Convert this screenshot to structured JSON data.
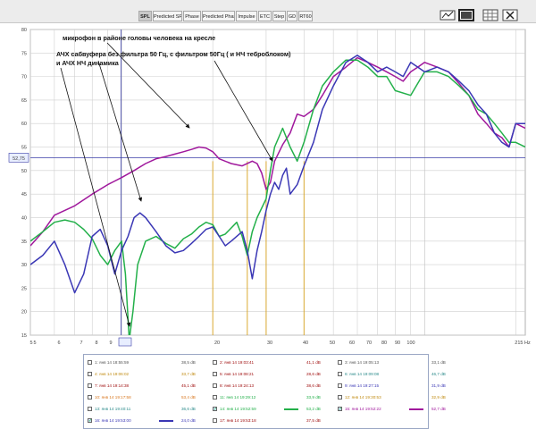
{
  "toolbar": {
    "tabs": [
      {
        "label": "SPL",
        "active": true
      },
      {
        "label": "Predicted SPL",
        "active": false
      },
      {
        "label": "Phase",
        "active": false
      },
      {
        "label": "Predicted Phase",
        "active": false
      },
      {
        "label": "Impulse",
        "active": false
      },
      {
        "label": "ETC",
        "active": false
      },
      {
        "label": "Step",
        "active": false
      },
      {
        "label": "GD",
        "active": false
      },
      {
        "label": "RT60",
        "active": false
      }
    ],
    "icons": [
      "trace-arrangement-icon",
      "window-icon",
      "grid-icon",
      "close-icon"
    ]
  },
  "graph": {
    "cursor_readout": "52,75",
    "x_cursor_readout": "9,96",
    "x_unit": "Hz",
    "annotations": {
      "line1": "микрофон в районе головы человека на кресле",
      "line2": "АЧХ сабвуфера без фильтра 50 Гц, с фильтром 50Гц ( и НЧ теброблоком)",
      "line3": "и АЧХ НЧ динамика"
    },
    "colors": {
      "magenta": "#a0189c",
      "green": "#23b04a",
      "blue": "#3a37b5",
      "cursor_line": "#3a3fa8",
      "marker_line": "#d8a21d",
      "grid": "#cfcfcf",
      "arrow": "#111111"
    }
  },
  "chart_data": {
    "type": "line",
    "title": "",
    "xlabel": "Hz",
    "ylabel": "",
    "x_scale": "log",
    "xlim": [
      5,
      215
    ],
    "ylim": [
      15,
      80
    ],
    "x_ticks": [
      "5",
      "5",
      "6",
      "7",
      "8",
      "9",
      "9,96",
      "20",
      "30",
      "40",
      "50",
      "60",
      "70",
      "80",
      "90",
      "100",
      "215 Hz"
    ],
    "y_ticks": [
      15,
      20,
      25,
      30,
      35,
      40,
      45,
      50,
      52.75,
      55,
      60,
      65,
      70,
      75,
      80
    ],
    "marker_frequencies": [
      20,
      26,
      30,
      40
    ],
    "cursor_y": 52.75,
    "grid": true,
    "series": [
      {
        "name": "",
        "color": "#a0189c",
        "x": [
          5,
          5.5,
          6,
          7,
          8,
          9,
          10,
          11,
          12,
          13,
          14,
          15,
          16,
          17,
          18,
          19,
          20,
          21,
          23,
          25,
          27,
          28,
          29,
          30,
          31,
          32,
          34,
          36,
          38,
          40,
          43,
          46,
          50,
          55,
          60,
          65,
          70,
          75,
          80,
          85,
          90,
          95,
          100,
          110,
          120,
          130,
          140,
          150,
          160,
          170,
          180,
          190,
          200,
          215
        ],
        "y": [
          34,
          37,
          40.5,
          42.5,
          45,
          47,
          48.5,
          50,
          51.5,
          52.5,
          53,
          53.5,
          54,
          54.5,
          55,
          54.8,
          54,
          52.5,
          51.5,
          51,
          52,
          51.5,
          49.5,
          46,
          47.5,
          52,
          55.5,
          58,
          62,
          61.5,
          63,
          66,
          70,
          72,
          74,
          73,
          72,
          71,
          70,
          69,
          71,
          72,
          73,
          72,
          71,
          68.5,
          66,
          62,
          60,
          58,
          57,
          55,
          60,
          59
        ]
      },
      {
        "name": "",
        "color": "#23b04a",
        "x": [
          5,
          5.5,
          6,
          6.5,
          7,
          7.5,
          8,
          8.5,
          9,
          9.5,
          10,
          10.3,
          10.6,
          10.9,
          11.3,
          12,
          13,
          14,
          15,
          16,
          17,
          18,
          19,
          20,
          21,
          22,
          24,
          25,
          26,
          27,
          28,
          30,
          31,
          32,
          34,
          36,
          38,
          40,
          43,
          46,
          50,
          55,
          60,
          65,
          70,
          75,
          80,
          90,
          100,
          110,
          120,
          130,
          140,
          150,
          160,
          170,
          180,
          190,
          200,
          215
        ],
        "y": [
          35,
          37,
          39,
          39.5,
          39,
          37.5,
          35.5,
          32,
          30,
          33,
          35,
          28,
          14,
          20,
          30,
          35,
          36,
          34.5,
          33.5,
          35.5,
          36.5,
          38,
          39,
          38.5,
          36,
          36.5,
          39,
          36,
          32,
          37,
          40,
          44,
          50,
          55,
          59,
          55,
          52,
          56,
          63,
          68,
          71,
          73.5,
          73.5,
          72,
          70,
          70,
          67,
          66,
          71,
          71,
          70,
          68,
          66,
          63,
          62,
          60,
          58,
          56,
          56,
          55
        ]
      },
      {
        "name": "",
        "color": "#3a37b5",
        "x": [
          5,
          5.5,
          6,
          6.5,
          7,
          7.5,
          8,
          8.5,
          9,
          9.5,
          10,
          10.5,
          11,
          11.5,
          12,
          13,
          14,
          15,
          16,
          17,
          18,
          19,
          20,
          21,
          22,
          23,
          25,
          26,
          27,
          28,
          29,
          30,
          31,
          32,
          33,
          34,
          35,
          36,
          38,
          40,
          43,
          46,
          50,
          55,
          60,
          65,
          70,
          75,
          80,
          85,
          90,
          95,
          100,
          110,
          120,
          130,
          140,
          150,
          160,
          170,
          180,
          190,
          200,
          215
        ],
        "y": [
          30,
          32,
          35,
          30,
          24,
          28,
          36,
          37.5,
          34,
          28,
          33,
          36,
          40,
          41,
          40,
          37,
          34,
          32.5,
          33,
          34.5,
          36,
          37.5,
          38,
          36,
          34,
          35,
          37,
          33,
          27,
          33,
          37,
          41.5,
          45,
          47.5,
          46,
          49,
          50.5,
          45,
          47,
          51,
          56,
          63,
          68,
          73,
          74.5,
          73,
          71,
          72,
          71,
          70,
          73,
          72,
          71,
          72,
          71,
          69,
          67,
          64,
          62,
          58,
          56,
          55,
          60,
          60
        ]
      }
    ]
  },
  "legend": {
    "rows": [
      {
        "label": "1: янв 14 18:55:59",
        "value": "38,5 dB",
        "color": "#555555",
        "checked": false
      },
      {
        "label": "2: янв 14 19:03:41",
        "value": "41,1 dB",
        "color": "#a01010",
        "checked": false
      },
      {
        "label": "3: янв 14 19:05:13",
        "value": "33,1 dB",
        "color": "#555555",
        "checked": false
      },
      {
        "label": "4: янв 14 19:06:02",
        "value": "33,7 dB",
        "color": "#c08a10",
        "checked": false
      },
      {
        "label": "5: янв 14 19:08:21",
        "value": "28,6 dB",
        "color": "#a01010",
        "checked": false
      },
      {
        "label": "6: янв 14 19:09:08",
        "value": "46,7 dB",
        "color": "#2a8a8a",
        "checked": false
      },
      {
        "label": "7: янв 14 19:14:38",
        "value": "45,1 dB",
        "color": "#a01010",
        "checked": false
      },
      {
        "label": "8: янв 14 19:24:13",
        "value": "38,6 dB",
        "color": "#a01010",
        "checked": false
      },
      {
        "label": "9: янв 14 19:27:15",
        "value": "31,9 dB",
        "color": "#3a37b5",
        "checked": false
      },
      {
        "label": "10: янв 14 19:17:58",
        "value": "53,4 dB",
        "color": "#d8761d",
        "checked": false
      },
      {
        "label": "11: янв 14 19:29:12",
        "value": "33,9 dB",
        "color": "#23b04a",
        "checked": false
      },
      {
        "label": "12: янв 14 19:30:53",
        "value": "32,9 dB",
        "color": "#c08a10",
        "checked": false
      },
      {
        "label": "13: янв 14 19:40:11",
        "value": "36,6 dB",
        "color": "#2a8a8a",
        "checked": false
      },
      {
        "label": "14: янв 14 19:52:59",
        "value": "53,2 dB",
        "color": "#23b04a",
        "checked": true
      },
      {
        "label": "15: янв 14 19:52:22",
        "value": "52,7 dB",
        "color": "#a0189c",
        "checked": true
      },
      {
        "label": "16: янв 14 19:53:00",
        "value": "24,0 dB",
        "color": "#3a37b5",
        "checked": true
      },
      {
        "label": "17: янв 14 19:53:18",
        "value": "37,5 dB",
        "color": "#a01010",
        "checked": false
      }
    ]
  }
}
